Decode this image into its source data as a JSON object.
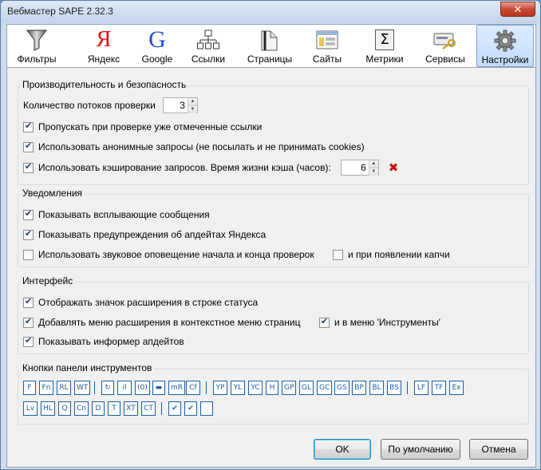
{
  "window": {
    "title": "Вебмастер SAPE 2.32.3",
    "close_glyph": "✕"
  },
  "toolbar": {
    "tabs": [
      {
        "label": "Фильтры",
        "icon": "funnel-icon"
      },
      {
        "label": "Яндекс",
        "icon": "yandex-icon",
        "glyph": "Я"
      },
      {
        "label": "Google",
        "icon": "google-icon",
        "glyph": "G"
      },
      {
        "label": "Ссылки",
        "icon": "links-tree-icon"
      },
      {
        "label": "Страницы",
        "icon": "pages-icon"
      },
      {
        "label": "Сайты",
        "icon": "sites-icon"
      },
      {
        "label": "Метрики",
        "icon": "metrics-sigma-icon",
        "glyph": "Σ"
      },
      {
        "label": "Сервисы",
        "icon": "services-key-icon"
      },
      {
        "label": "Настройки",
        "icon": "gear-icon"
      }
    ],
    "active_tab": "Настройки"
  },
  "performance": {
    "title": "Производительность и безопасность",
    "threads_label": "Количество потоков проверки",
    "threads_value": "3",
    "skip_checked_label": "Пропускать при проверке уже отмеченные ссылки",
    "skip_checked": true,
    "anonymous_label": "Использовать анонимные запросы (не посылать и не принимать cookies)",
    "anonymous": true,
    "cache_label": "Использовать кэширование запросов. Время жизни кэша (часов):",
    "cache": true,
    "cache_hours": "6"
  },
  "notifications": {
    "title": "Уведомления",
    "popup_label": "Показывать всплывающие сообщения",
    "popup": true,
    "yandex_updates_label": "Показывать предупреждения об апдейтах Яндекса",
    "yandex_updates": true,
    "sound_label": "Использовать звуковое оповещение начала и конца проверок",
    "sound": false,
    "captcha_label": "и при появлении капчи",
    "captcha": false
  },
  "interface": {
    "title": "Интерфейс",
    "statusbar_label": "Отображать значок расширения в строке статуса",
    "statusbar": true,
    "context_menu_label": "Добавлять меню расширения в контекстное меню страниц",
    "context_menu": true,
    "tools_menu_label": "и в меню 'Инструменты'",
    "tools_menu": true,
    "informer_label": "Показывать информер апдейтов",
    "informer": true
  },
  "panel_buttons": {
    "title": "Кнопки панели инструментов",
    "row1": [
      "F",
      "Fn",
      "RL",
      "WT",
      "|",
      "↻",
      "il",
      "(0)",
      "▬",
      "mR",
      "Cf",
      "|",
      "YP",
      "YL",
      "YC",
      "H",
      "GP",
      "GL",
      "GC",
      "GS",
      "BP",
      "BL",
      "BS",
      "|",
      "LF",
      "TF",
      "Ex"
    ],
    "row2": [
      "Lv",
      "HL",
      "Q",
      "Cn",
      "D",
      "T",
      "XT",
      "CT",
      "|",
      "✔",
      "✔",
      ""
    ]
  },
  "footer": {
    "ok_label": "OK",
    "defaults_label": "По умолчанию",
    "cancel_label": "Отмена"
  },
  "colors": {
    "accent": "#1c5fa6",
    "remove": "#cc1111"
  }
}
